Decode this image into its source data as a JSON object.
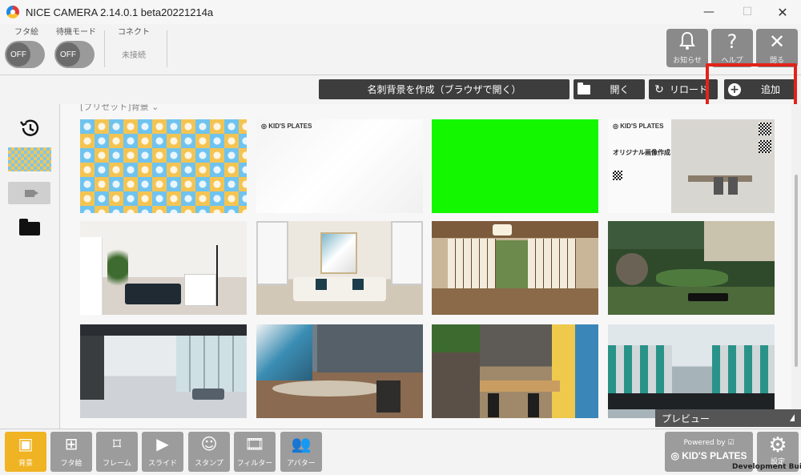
{
  "window": {
    "title": "NICE CAMERA 2.14.0.1 beta20221214a",
    "minimize": "—",
    "maximize": "☐",
    "close": "✕"
  },
  "top_toolbar": {
    "toggle_futae": {
      "label": "フタ絵",
      "state": "OFF"
    },
    "toggle_standby": {
      "label": "待機モード",
      "state": "OFF"
    },
    "connect": {
      "label": "コネクト",
      "status": "未接続"
    },
    "notice_button": {
      "label": "お知らせ",
      "icon": "bell-icon"
    },
    "help_button": {
      "label": "ヘルプ",
      "icon": "question-icon"
    },
    "close_button": {
      "label": "閉る",
      "icon": "close-icon"
    }
  },
  "action_bar": {
    "create_card": "名刺背景を作成（ブラウザで開く）",
    "open": "開く",
    "reload": "リロード",
    "add": "追加",
    "add_symbol": "+"
  },
  "gallery": {
    "section_title": "[プリセット]背景 ⌄",
    "items": [
      {
        "name": "pattern-clock"
      },
      {
        "name": "kids-plates-white",
        "logo": "◎ KID'S PLATES"
      },
      {
        "name": "green-screen"
      },
      {
        "name": "kids-plates-office",
        "logo": "◎ KID'S PLATES",
        "caption": "オリジナル画像作成"
      },
      {
        "name": "living-room"
      },
      {
        "name": "sofa-room"
      },
      {
        "name": "japanese-room"
      },
      {
        "name": "japanese-garden"
      },
      {
        "name": "office-hall"
      },
      {
        "name": "meeting-room"
      },
      {
        "name": "cowork-space"
      },
      {
        "name": "office-desks"
      }
    ]
  },
  "preview": {
    "label": "プレビュー"
  },
  "bottom_bar": {
    "tools": [
      {
        "label": "背景",
        "icon": "background-icon",
        "glyph": "▣"
      },
      {
        "label": "フタ絵",
        "icon": "lid-image-icon",
        "glyph": "⊞"
      },
      {
        "label": "フレーム",
        "icon": "frame-icon",
        "glyph": "⌑"
      },
      {
        "label": "スライド",
        "icon": "slide-icon",
        "glyph": "▶"
      },
      {
        "label": "スタンプ",
        "icon": "stamp-icon",
        "glyph": "☺"
      },
      {
        "label": "フィルター",
        "icon": "filter-icon",
        "glyph": "🎞"
      },
      {
        "label": "アバター",
        "icon": "avatar-icon",
        "glyph": "👥"
      }
    ],
    "powered_by": "Powered by ☑",
    "brand": "◎ KID'S PLATES",
    "settings_label": "設定",
    "dev_build": "Development Build"
  },
  "colors": {
    "accent_active": "#f0b323",
    "highlight": "#e2231a",
    "green_screen": "#13f700",
    "button_dark": "#3d3d3d"
  }
}
